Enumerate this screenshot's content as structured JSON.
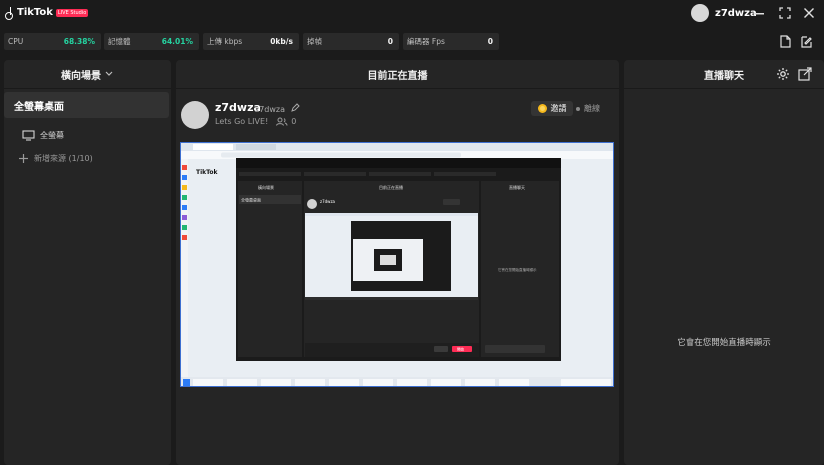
{
  "app": {
    "logo_text": "TikTok",
    "logo_badge": "LIVE Studio",
    "username": "z7dwza"
  },
  "stats": [
    {
      "label": "CPU",
      "value": "68.38%",
      "color": "#25d2a0"
    },
    {
      "label": "記憶體",
      "value": "64.01%",
      "color": "#25d2a0"
    },
    {
      "label": "上傳 kbps",
      "value": "0kb/s",
      "color": "#f2f2f2"
    },
    {
      "label": "掉幀",
      "value": "0",
      "color": "#f2f2f2"
    },
    {
      "label": "編碼器 Fps",
      "value": "0",
      "color": "#f2f2f2"
    }
  ],
  "scenes_panel": {
    "title": "橫向場景",
    "scene_name": "全螢幕桌面",
    "source_item": "全螢幕",
    "add_source": "新增來源 (1/10)"
  },
  "live_panel": {
    "title": "目前正在直播",
    "name": "z7dwza",
    "handle": "z7dwza",
    "stream_title": "Lets Go LIVE!",
    "viewer_count": "0",
    "invite_label": "邀請",
    "disconnect_label": "離線"
  },
  "chat_panel": {
    "title": "直播聊天",
    "placeholder": "它會在您開始直播時顯示"
  },
  "preview_inner": {
    "title": "目前正在直播",
    "scene_title": "橫向場景",
    "scene_name": "全螢幕桌面",
    "chat_title": "直播聊天",
    "placeholder": "它會在您開始直播時顯示",
    "name": "z7dwza",
    "logo_text": "TikTok",
    "go_live": "開始"
  },
  "colors": {
    "accent": "#fe2c55",
    "good": "#25d2a0"
  }
}
